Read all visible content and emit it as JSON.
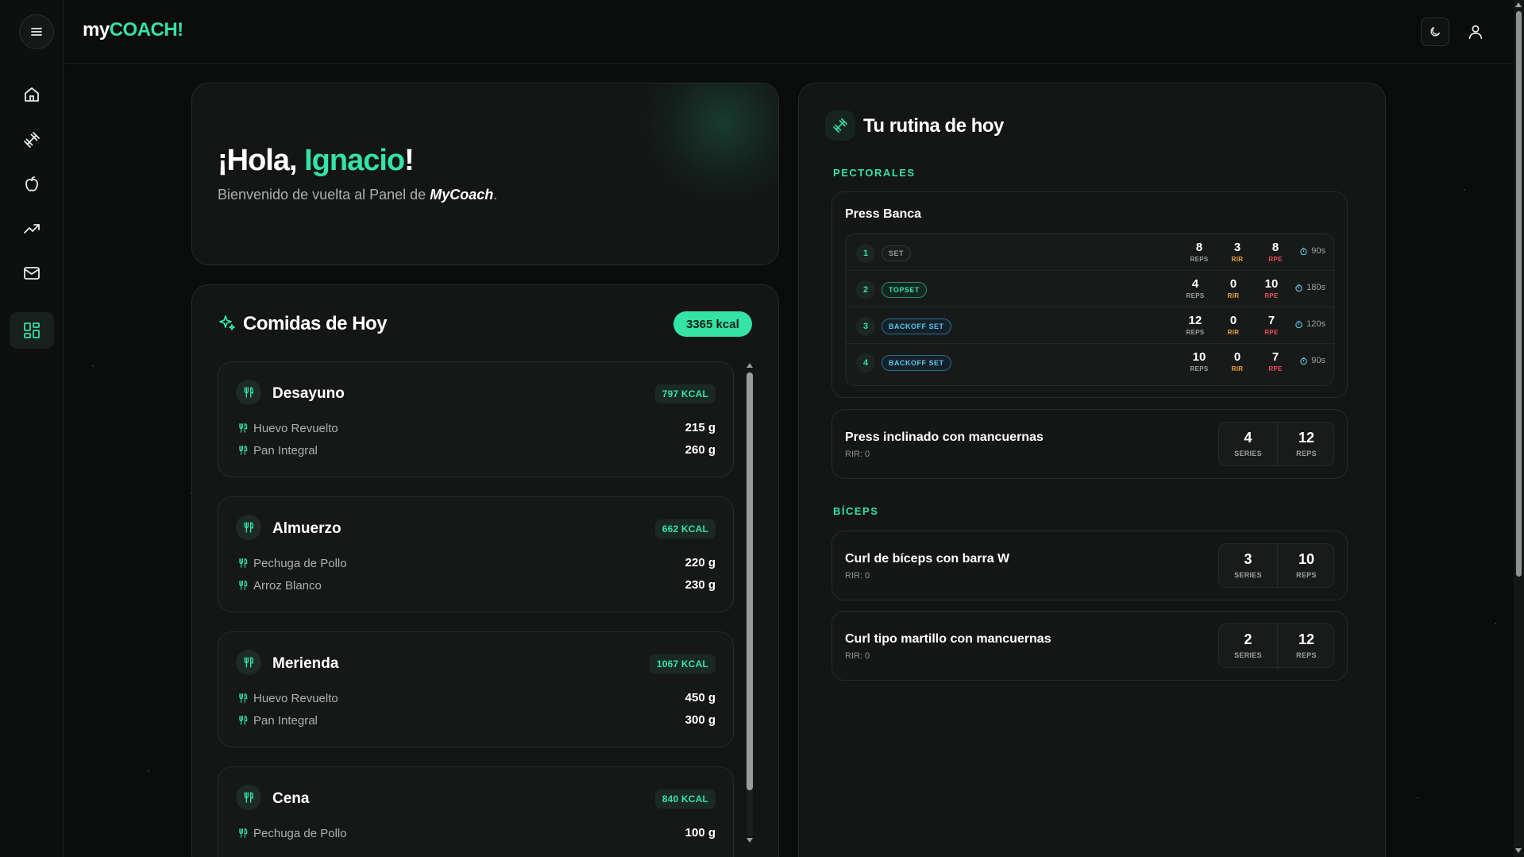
{
  "app": {
    "brand_prefix": "my",
    "brand_accent": "COACH!",
    "accent_color": "#34e3a5"
  },
  "topbar": {
    "theme_icon": "moon-icon",
    "user_icon": "user-icon"
  },
  "sidebar": {
    "menu_icon": "hamburger-icon",
    "items": [
      {
        "name": "home",
        "icon": "home-icon"
      },
      {
        "name": "workouts",
        "icon": "dumbbell-icon"
      },
      {
        "name": "nutrition",
        "icon": "apple-icon"
      },
      {
        "name": "progress",
        "icon": "trending-up-icon"
      },
      {
        "name": "messages",
        "icon": "mail-icon"
      },
      {
        "name": "dashboard",
        "icon": "grid-icon",
        "active": true
      }
    ]
  },
  "hello": {
    "prefix": "¡Hola, ",
    "name": "Ignacio",
    "suffix": "!",
    "subtitle_prefix": "Bienvenido de vuelta al Panel de ",
    "subtitle_brand": "MyCoach",
    "subtitle_suffix": "."
  },
  "meals": {
    "title": "Comidas de Hoy",
    "total_kcal": "3365 kcal",
    "items": [
      {
        "name": "Desayuno",
        "kcal": "797 KCAL",
        "foods": [
          {
            "name": "Huevo Revuelto",
            "qty": "215 g"
          },
          {
            "name": "Pan Integral",
            "qty": "260 g"
          }
        ]
      },
      {
        "name": "Almuerzo",
        "kcal": "662 KCAL",
        "foods": [
          {
            "name": "Pechuga de Pollo",
            "qty": "220 g"
          },
          {
            "name": "Arroz Blanco",
            "qty": "230 g"
          }
        ]
      },
      {
        "name": "Merienda",
        "kcal": "1067 KCAL",
        "foods": [
          {
            "name": "Huevo Revuelto",
            "qty": "450 g"
          },
          {
            "name": "Pan Integral",
            "qty": "300 g"
          }
        ]
      },
      {
        "name": "Cena",
        "kcal": "840 KCAL",
        "foods": [
          {
            "name": "Pechuga de Pollo",
            "qty": "100 g"
          }
        ]
      }
    ]
  },
  "routine": {
    "title": "Tu rutina de hoy",
    "metric_labels": {
      "reps": "REPS",
      "rir": "RIR",
      "rpe": "RPE",
      "series": "SERIES"
    },
    "groups": [
      {
        "label": "PECTORALES",
        "exercises": [
          {
            "name": "Press Banca",
            "sets": [
              {
                "num": "1",
                "type": "SET",
                "reps": "8",
                "rir": "3",
                "rpe": "8",
                "rest": "90s"
              },
              {
                "num": "2",
                "type": "TOPSET",
                "reps": "4",
                "rir": "0",
                "rpe": "10",
                "rest": "180s"
              },
              {
                "num": "3",
                "type": "BACKOFF SET",
                "reps": "12",
                "rir": "0",
                "rpe": "7",
                "rest": "120s"
              },
              {
                "num": "4",
                "type": "BACKOFF SET",
                "reps": "10",
                "rir": "0",
                "rpe": "7",
                "rest": "90s"
              }
            ]
          },
          {
            "name": "Press inclinado con mancuernas",
            "rir": "RIR: 0",
            "series": "4",
            "reps": "12"
          }
        ]
      },
      {
        "label": "BÍCEPS",
        "exercises": [
          {
            "name": "Curl de bíceps con barra W",
            "rir": "RIR: 0",
            "series": "3",
            "reps": "10"
          },
          {
            "name": "Curl tipo martillo con mancuernas",
            "rir": "RIR: 0",
            "series": "2",
            "reps": "12"
          }
        ]
      }
    ]
  }
}
